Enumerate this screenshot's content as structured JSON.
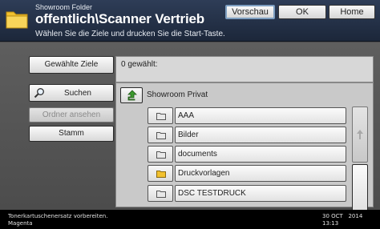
{
  "header": {
    "folder_label": "Showroom Folder",
    "path_title": "offentlich\\Scanner Vertrieb",
    "instruction": "Wählen Sie die Ziele und drucken Sie die Start-Taste.",
    "buttons": {
      "preview": "Vorschau",
      "ok": "OK",
      "home": "Home"
    }
  },
  "left": {
    "selected_targets": "Gewählte Ziele",
    "search": "Suchen",
    "view_folder": "Ordner ansehen",
    "root": "Stamm"
  },
  "selection": {
    "count_text": "0 gewählt:"
  },
  "browser": {
    "current_folder": "Showroom Privat",
    "items": [
      {
        "name": "AAA",
        "highlighted": false
      },
      {
        "name": "Bilder",
        "highlighted": false
      },
      {
        "name": "documents",
        "highlighted": false
      },
      {
        "name": "Druckvorlagen",
        "highlighted": true
      },
      {
        "name": "DSC TESTDRUCK",
        "highlighted": false
      }
    ]
  },
  "footer": {
    "status_line1": "Tonerkartuschenersatz vorbereiten.",
    "status_line2": "Magenta",
    "date": "30 OCT   2014",
    "time": "13:13"
  },
  "colors": {
    "header_bg": "#24324a",
    "folder_yellow": "#f2c12e",
    "arrow_green": "#3c9a2e"
  }
}
